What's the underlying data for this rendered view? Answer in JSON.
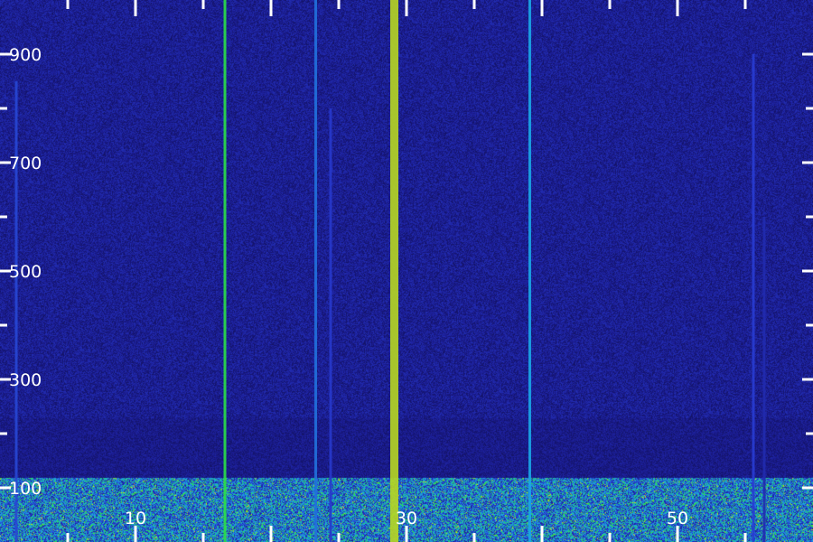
{
  "chart_data": {
    "type": "heatmap",
    "title": "",
    "xlabel": "",
    "ylabel": "",
    "xlim": [
      0,
      60
    ],
    "ylim": [
      0,
      1000
    ],
    "x_ticks": [
      {
        "value": 10,
        "label": "10"
      },
      {
        "value": 30,
        "label": "30"
      },
      {
        "value": 50,
        "label": "50"
      }
    ],
    "y_ticks": [
      {
        "value": 100,
        "label": "100"
      },
      {
        "value": 300,
        "label": "300"
      },
      {
        "value": 500,
        "label": "500"
      },
      {
        "value": 700,
        "label": "700"
      },
      {
        "value": 900,
        "label": "900"
      }
    ],
    "major_tick_step_x": 10,
    "minor_tick_step_x": 5,
    "major_tick_step_y": 200,
    "minor_tick_step_y": 100,
    "colors": {
      "low": "#1a1a8c",
      "mid": "#1aa6e6",
      "high": "#2de636",
      "peak": "#e6d21a",
      "tick": "#ffffff"
    },
    "noise_floor": 0.22,
    "low_band": {
      "y_from": 0,
      "y_to": 120,
      "level": 0.55
    },
    "dark_band": {
      "y_from": 120,
      "y_to": 230,
      "level": 0.12
    },
    "lines": [
      {
        "x": 1.2,
        "intensity": 0.42,
        "y_top": 850
      },
      {
        "x": 16.6,
        "intensity": 0.78,
        "y_top": 1000
      },
      {
        "x": 23.3,
        "intensity": 0.5,
        "y_top": 1000
      },
      {
        "x": 24.4,
        "intensity": 0.38,
        "y_top": 800
      },
      {
        "x": 29.1,
        "intensity": 0.95,
        "y_top": 1000
      },
      {
        "x": 39.1,
        "intensity": 0.6,
        "y_top": 1000
      },
      {
        "x": 55.6,
        "intensity": 0.4,
        "y_top": 900
      },
      {
        "x": 56.4,
        "intensity": 0.3,
        "y_top": 600
      }
    ]
  }
}
